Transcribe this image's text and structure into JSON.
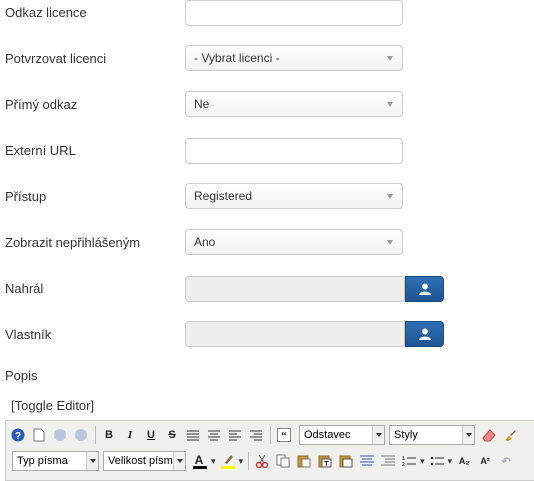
{
  "form": {
    "odkaz_licence": {
      "label": "Odkaz licence",
      "value": ""
    },
    "potvrzovat_licenci": {
      "label": "Potvrzovat licenci",
      "value": "- Vybrat licenci -"
    },
    "primy_odkaz": {
      "label": "Přímý odkaz",
      "value": "Ne"
    },
    "externi_url": {
      "label": "Externí URL",
      "value": ""
    },
    "pristup": {
      "label": "Přístup",
      "value": "Registered"
    },
    "zobrazit": {
      "label": "Zobrazit nepřihlášeným",
      "value": "Ano"
    },
    "nahral": {
      "label": "Nahrál",
      "value": ""
    },
    "vlastnik": {
      "label": "Vlastník",
      "value": ""
    },
    "popis": {
      "label": "Popis"
    }
  },
  "editor": {
    "toggle_label": "[Toggle Editor]",
    "format_select": "Odstavec",
    "styles_select": "Styly",
    "font_select": "Typ písma",
    "size_select": "Velikost písma",
    "buttons": {
      "bold": "B",
      "italic": "I",
      "underline": "U",
      "strike": "S",
      "subscript": "A₂",
      "superscript": "A²"
    }
  },
  "colors": {
    "user_button": "#1f5594",
    "field_border": "#cccccc"
  }
}
